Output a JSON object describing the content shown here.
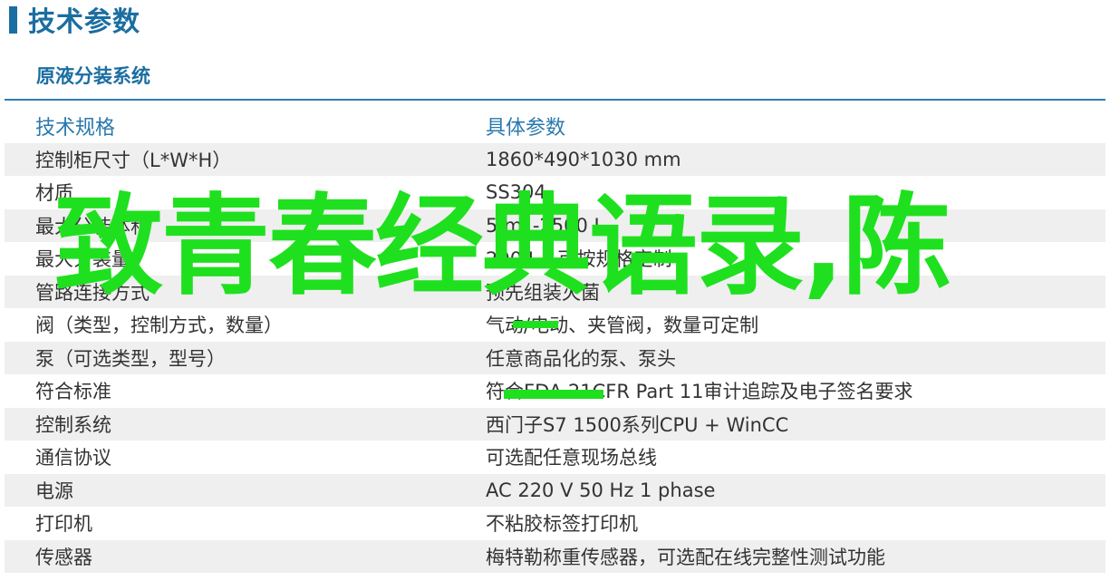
{
  "heading": {
    "title": "技术参数"
  },
  "section": {
    "subtitle": "原液分装系统"
  },
  "table": {
    "header": {
      "left": "技术规格",
      "right": "具体参数"
    },
    "rows": [
      {
        "left": "控制柜尺寸（L*W*H）",
        "right": "1860*490*1030 mm"
      },
      {
        "left": "材质",
        "right": "SS304"
      },
      {
        "left": "最大分装体积",
        "right": "5 mL-2500 L"
      },
      {
        "left": "最大分装量",
        "right": "200 L，可按规格定制"
      },
      {
        "left": "管路连接方式",
        "right": "预先组装灭菌"
      },
      {
        "left": "阀（类型，控制方式，数量）",
        "right": "气动/电动、夹管阀，数量可定制"
      },
      {
        "left": "泵（可选类型，型号）",
        "right": "任意商品化的泵、泵头"
      },
      {
        "left": "符合标准",
        "right": "符合FDA 21CFR Part 11审计追踪及电子签名要求"
      },
      {
        "left": "控制系统",
        "right": "西门子S7 1500系列CPU + WinCC"
      },
      {
        "left": "通信协议",
        "right": "可选配任意现场总线"
      },
      {
        "left": "电源",
        "right": "AC 220 V 50 Hz 1 phase"
      },
      {
        "left": "打印机",
        "right": "不粘胶标签打印机"
      },
      {
        "left": "传感器",
        "right": "梅特勒称重传感器，可选配在线完整性测试功能"
      }
    ]
  },
  "overlay": {
    "text": "致青春经典语录,陈"
  },
  "colors": {
    "accent": "#1b6ea1",
    "overlay": "#1fe01f",
    "row_shade": "#efefef"
  }
}
